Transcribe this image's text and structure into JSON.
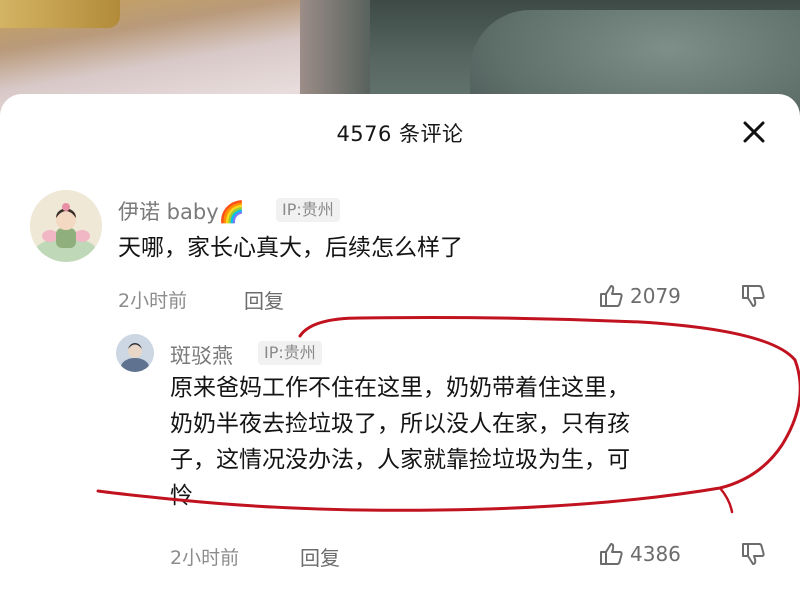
{
  "header": {
    "title": "4576 条评论",
    "close_icon": "close-icon"
  },
  "comments": [
    {
      "username": "伊诺 baby🌈",
      "ip": "IP:贵州",
      "text": "天哪，家长心真大，后续怎么样了",
      "time": "2小时前",
      "reply": "回复",
      "likes": "2079"
    }
  ],
  "replies": [
    {
      "username": "斑驳燕",
      "ip": "IP:贵州",
      "text_lines": [
        "原来爸妈工作不住在这里，奶奶带着住这里，",
        "奶奶半夜去捡垃圾了，所以没人在家，只有孩",
        "子，这情况没办法，人家就靠捡垃圾为生，可",
        "怜"
      ],
      "time": "2小时前",
      "reply": "回复",
      "likes": "4386"
    }
  ],
  "colors": {
    "annotation": "#c1121f",
    "sheet": "#ffffff"
  }
}
